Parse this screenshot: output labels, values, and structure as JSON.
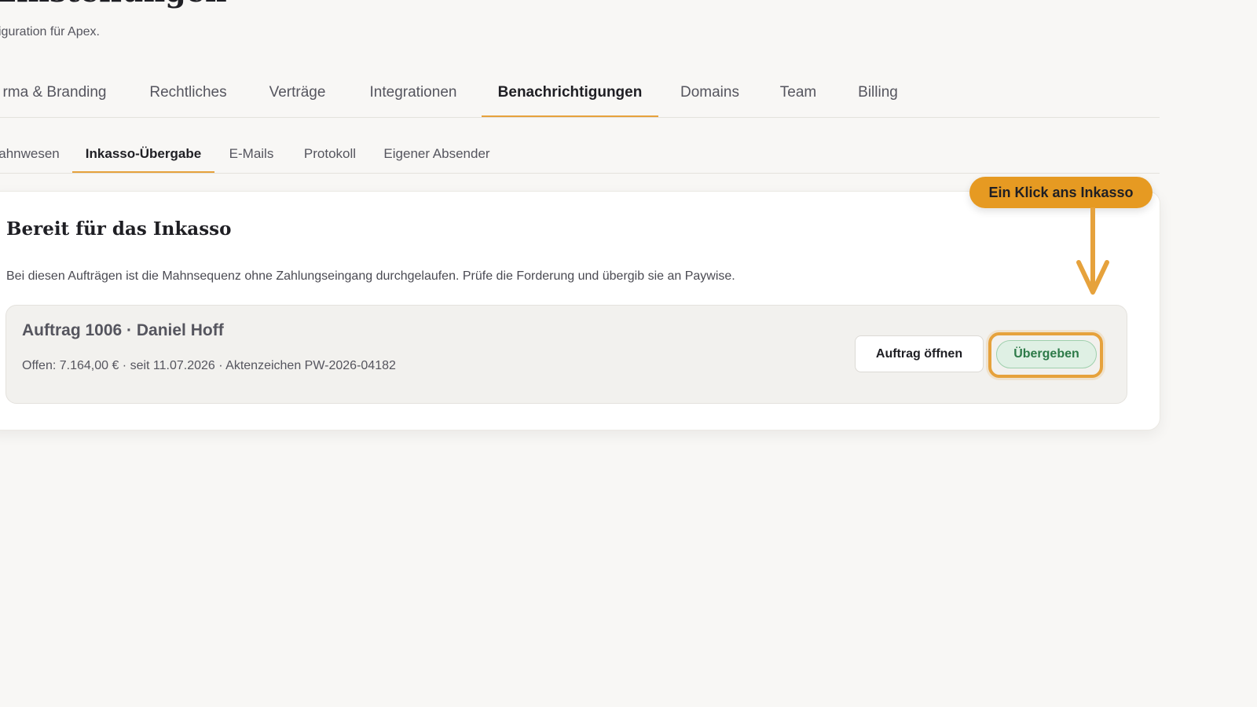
{
  "page": {
    "title": "Einstellungen",
    "subtitle": "iguration für Apex."
  },
  "main_tabs": [
    {
      "label": "rma & Branding",
      "active": false
    },
    {
      "label": "Rechtliches",
      "active": false
    },
    {
      "label": "Verträge",
      "active": false
    },
    {
      "label": "Integrationen",
      "active": false
    },
    {
      "label": "Benachrichtigungen",
      "active": true
    },
    {
      "label": "Domains",
      "active": false
    },
    {
      "label": "Team",
      "active": false
    },
    {
      "label": "Billing",
      "active": false
    }
  ],
  "sub_tabs": [
    {
      "label": "ahnwesen",
      "active": false
    },
    {
      "label": "Inkasso-Übergabe",
      "active": true
    },
    {
      "label": "E-Mails",
      "active": false
    },
    {
      "label": "Protokoll",
      "active": false
    },
    {
      "label": "Eigener Absender",
      "active": false
    }
  ],
  "card": {
    "title": "Bereit für das Inkasso",
    "description": "Bei diesen Aufträgen ist die Mahnsequenz ohne Zahlungseingang durchgelaufen. Prüfe die Forderung und übergib sie an Paywise."
  },
  "order": {
    "title": "Auftrag 1006 · Daniel Hoff",
    "meta": "Offen: 7.164,00 € · seit 11.07.2026 · Aktenzeichen PW-2026-04182",
    "open_label": "Auftrag öffnen",
    "handover_label": "Übergeben"
  },
  "callout": {
    "text": "Ein Klick ans Inkasso"
  },
  "colors": {
    "accent": "#e6a23c",
    "success_bg": "#dff0e4",
    "success_text": "#2d7a48",
    "page_bg": "#f8f7f5"
  }
}
